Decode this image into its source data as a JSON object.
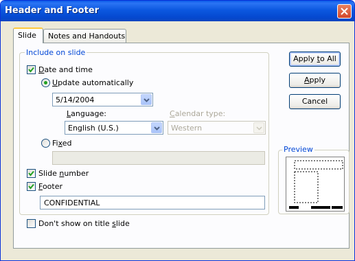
{
  "window": {
    "title": "Header and Footer"
  },
  "tabs": [
    {
      "label": "Slide",
      "active": true
    },
    {
      "label": "Notes and Handouts",
      "active": false
    }
  ],
  "include_group": {
    "label": "Include on slide",
    "date_time": {
      "prefix": "",
      "mnemonic": "D",
      "rest": "ate and time",
      "checked": true
    },
    "update_auto": {
      "mnemonic": "U",
      "rest": "pdate automatically",
      "selected": true
    },
    "date_value": "5/14/2004",
    "language": {
      "mnemonic": "L",
      "rest": "anguage:",
      "value": "English (U.S.)"
    },
    "calendar": {
      "mnemonic": "C",
      "rest": "alendar type:",
      "value": "Western",
      "disabled": true
    },
    "fixed": {
      "prefix": "Fi",
      "mnemonic": "x",
      "rest": "ed",
      "selected": false,
      "value": ""
    },
    "slide_number": {
      "prefix": "Slide ",
      "mnemonic": "n",
      "rest": "umber",
      "checked": true
    },
    "footer": {
      "prefix": "",
      "mnemonic": "F",
      "rest": "ooter",
      "checked": true,
      "value": "CONFIDENTIAL"
    }
  },
  "dont_show": {
    "prefix": "Don't show on title ",
    "mnemonic": "s",
    "rest": "lide",
    "checked": false
  },
  "buttons": {
    "apply_all": {
      "prefix": "Apply ",
      "mnemonic": "t",
      "rest": "o All"
    },
    "apply": {
      "prefix": "",
      "mnemonic": "A",
      "rest": "pply"
    },
    "cancel": "Cancel"
  },
  "preview": {
    "label": "Preview"
  },
  "colors": {
    "title_bar": "#0a5ae8",
    "group_label": "#0046d5",
    "check": "#21a121",
    "close_button": "#d4472a"
  }
}
